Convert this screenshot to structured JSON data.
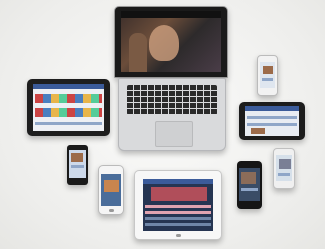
{
  "scene": {
    "background": "#f4f4f2",
    "devices": [
      {
        "name": "laptop"
      },
      {
        "name": "tablet-left"
      },
      {
        "name": "phone-top-right"
      },
      {
        "name": "tablet-right"
      },
      {
        "name": "phone-middle-left"
      },
      {
        "name": "phone-white"
      },
      {
        "name": "tablet-bottom"
      },
      {
        "name": "phone-bottom-right-black"
      },
      {
        "name": "phone-bottom-right-white"
      }
    ]
  }
}
